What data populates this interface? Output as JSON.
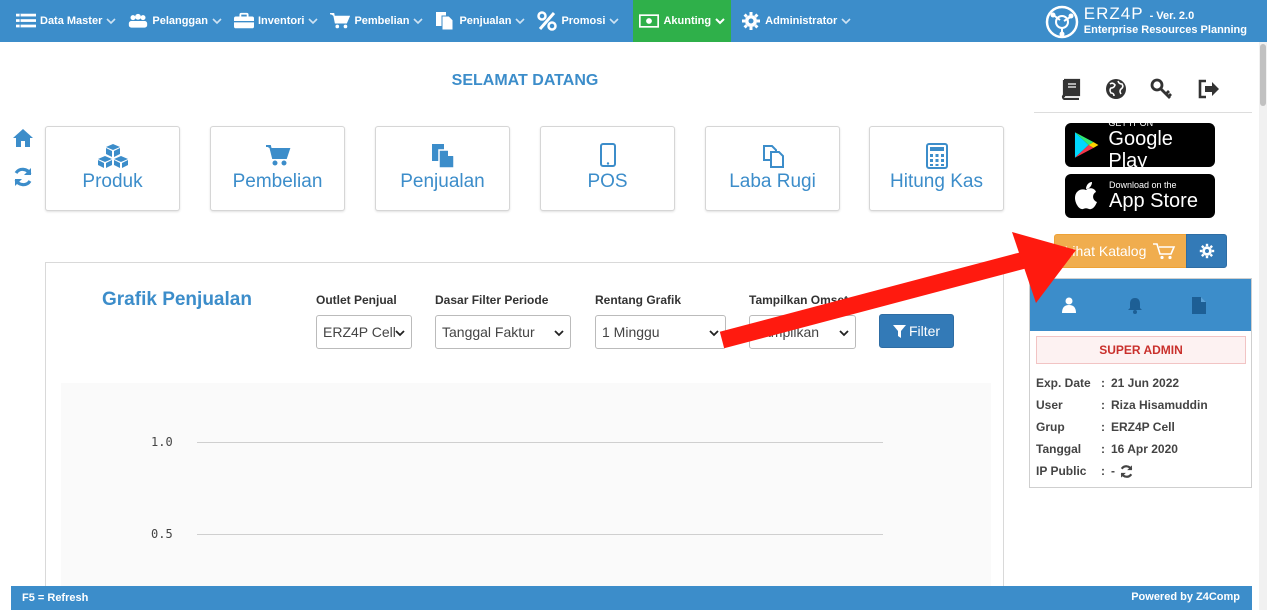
{
  "nav": {
    "items": [
      {
        "label": "Data Master",
        "icon": "list-icon"
      },
      {
        "label": "Pelanggan",
        "icon": "users-icon"
      },
      {
        "label": "Inventori",
        "icon": "briefcase-icon"
      },
      {
        "label": "Pembelian",
        "icon": "cart-icon"
      },
      {
        "label": "Penjualan",
        "icon": "files-icon"
      },
      {
        "label": "Promosi",
        "icon": "percent-icon"
      },
      {
        "label": "Akunting",
        "icon": "money-icon"
      },
      {
        "label": "Administrator",
        "icon": "gear-icon"
      }
    ],
    "active": "Akunting",
    "active_color": "#2fb04a",
    "bar_color": "#3c8dca"
  },
  "brand": {
    "name": "ERZ4P",
    "version": "- Ver. 2.0",
    "subtitle": "Enterprise Resources Planning"
  },
  "welcome": "SELAMAT DATANG",
  "tiles": [
    {
      "label": "Produk",
      "icon": "cubes-icon"
    },
    {
      "label": "Pembelian",
      "icon": "cart-icon"
    },
    {
      "label": "Penjualan",
      "icon": "files-icon"
    },
    {
      "label": "POS",
      "icon": "tablet-icon"
    },
    {
      "label": "Laba Rugi",
      "icon": "copy-icon"
    },
    {
      "label": "Hitung Kas",
      "icon": "calculator-icon"
    }
  ],
  "chart": {
    "title": "Grafik Penjualan",
    "filters": {
      "outlet": {
        "label": "Outlet Penjual",
        "value": "ERZ4P Cell"
      },
      "dasar": {
        "label": "Dasar Filter Periode",
        "value": "Tanggal Faktur"
      },
      "rentang": {
        "label": "Rentang Grafik",
        "value": "1 Minggu"
      },
      "omset": {
        "label": "Tampilkan Omset",
        "value": "Tampilkan"
      }
    },
    "filter_button": "Filter"
  },
  "chart_data": {
    "type": "line",
    "y_ticks": [
      "1.0",
      "0.5"
    ],
    "series": []
  },
  "store": {
    "google": {
      "small": "GET IT ON",
      "big": "Google Play"
    },
    "apple": {
      "small": "Download on the",
      "big": "App Store"
    }
  },
  "catalog_button": "Lihat Katalog",
  "profile": {
    "role": "SUPER ADMIN",
    "rows": [
      {
        "key": "Exp. Date",
        "sep": ":",
        "value": "21 Jun 2022"
      },
      {
        "key": "User",
        "sep": ":",
        "value": "Riza Hisamuddin"
      },
      {
        "key": "Grup",
        "sep": ":",
        "value": "ERZ4P Cell"
      },
      {
        "key": "Tanggal",
        "sep": ":",
        "value": "16 Apr 2020"
      },
      {
        "key": "IP Public",
        "sep": ":",
        "value": "-"
      }
    ]
  },
  "footer": {
    "left": "F5 = Refresh",
    "right": "Powered by Z4Comp"
  }
}
